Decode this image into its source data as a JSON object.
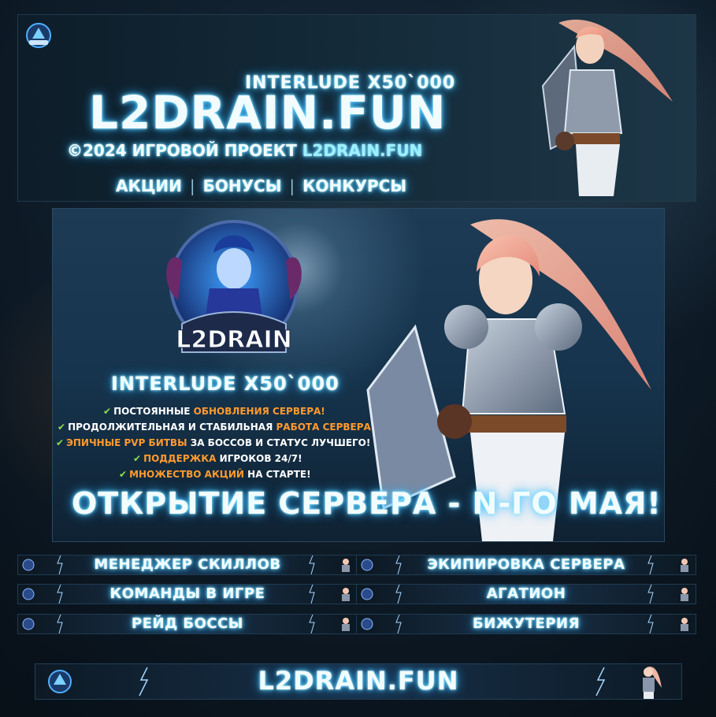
{
  "top_banner": {
    "subtitle": "INTERLUDE X50`000",
    "title": "L2DRAIN.FUN",
    "copyright_prefix": "©2024 ИГРОВОЙ ПРОЕКТ ",
    "copyright_site": "L2DRAIN.FUN",
    "links": [
      "АКЦИИ",
      "БОНУСЫ",
      "КОНКУРСЫ"
    ]
  },
  "poster": {
    "logo_text": "L2DRAIN",
    "interlude": "INTERLUDE X50`000",
    "features": [
      {
        "a": "ПОСТОЯННЫЕ ",
        "b": "ОБНОВЛЕНИЯ СЕРВЕРА!",
        "c": ""
      },
      {
        "a": "ПРОДОЛЖИТЕЛЬНАЯ И СТАБИЛЬНАЯ ",
        "b": "РАБОТА СЕРВЕРА!",
        "c": ""
      },
      {
        "a": "",
        "b": "ЭПИЧНЫЕ PVP БИТВЫ",
        "c": " ЗА БОССОВ И СТАТУС ЛУЧШЕГО!"
      },
      {
        "a": "",
        "b": "ПОДДЕРЖКА",
        "c": " ИГРОКОВ 24/7!"
      },
      {
        "a": "",
        "b": "МНОЖЕСТВО АКЦИЙ",
        "c": " НА СТАРТЕ!"
      }
    ],
    "opening": "ОТКРЫТИЕ СЕРВЕРА - N-ГО МАЯ!"
  },
  "menu": [
    "МЕНЕДЖЕР СКИЛЛОВ",
    "ЭКИПИРОВКА СЕРВЕРА",
    "КОМАНДЫ В ИГРЕ",
    "АГАТИОН",
    "РЕЙД БОССЫ",
    "БИЖУТЕРИЯ"
  ],
  "bottom_banner": {
    "title": "L2DRAIN.FUN"
  },
  "colors": {
    "glow": "#6fe3ff",
    "accent_orange": "#ff9a2e",
    "check_green": "#8ee04d",
    "panel_dark": "#0d1d29"
  }
}
